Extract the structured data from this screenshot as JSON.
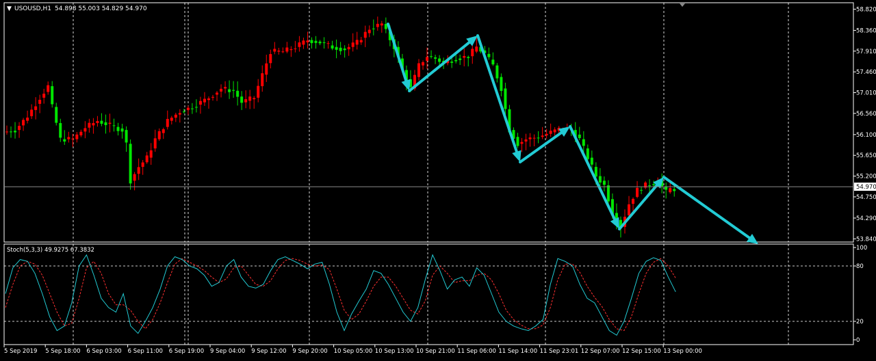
{
  "header": {
    "arrow_glyph": "▼",
    "symbol": "USOUSD,H1",
    "ohlc": "54.898 55.003 54.829 54.970"
  },
  "indicator": {
    "label": "Stoch(5,3,3) 49.9275 67.3832",
    "levels": [
      "100",
      "80",
      "20",
      "0"
    ]
  },
  "colors": {
    "background": "#000000",
    "bull": "#00e600",
    "bear": "#ff0000",
    "arrow": "#22cbd4",
    "grid": "#ffffff",
    "axis_text": "#ffffff",
    "bid_line": "#8c8c8c",
    "stoch_main": "#22cbd4",
    "stoch_signal": "#ff3030"
  },
  "chart_data": {
    "type": "candlestick",
    "price_axis": {
      "ticks": [
        "58.820",
        "58.360",
        "57.910",
        "57.460",
        "57.010",
        "56.560",
        "56.100",
        "55.650",
        "55.200",
        "54.750",
        "54.290",
        "53.840"
      ],
      "range": [
        53.8,
        58.9
      ],
      "current_price": "54.970",
      "current_value": 54.97
    },
    "time_labels": [
      "5 Sep 2019",
      "5 Sep 18:00",
      "6 Sep 03:00",
      "6 Sep 11:00",
      "6 Sep 19:00",
      "9 Sep 04:00",
      "9 Sep 12:00",
      "9 Sep 20:00",
      "10 Sep 05:00",
      "10 Sep 13:00",
      "10 Sep 21:00",
      "11 Sep 06:00",
      "11 Sep 14:00",
      "11 Sep 23:01",
      "12 Sep 07:00",
      "12 Sep 15:00",
      "13 Sep 00:00"
    ],
    "price_path": [
      [
        0,
        56.15
      ],
      [
        3,
        56.2
      ],
      [
        6,
        56.5
      ],
      [
        9,
        56.9
      ],
      [
        11,
        57.15
      ],
      [
        12,
        56.7
      ],
      [
        14,
        56.0
      ],
      [
        17,
        56.0
      ],
      [
        20,
        56.25
      ],
      [
        23,
        56.4
      ],
      [
        26,
        56.3
      ],
      [
        29,
        56.2
      ],
      [
        30,
        55.9
      ],
      [
        31,
        55.1
      ],
      [
        33,
        55.4
      ],
      [
        35,
        55.6
      ],
      [
        37,
        56.0
      ],
      [
        40,
        56.4
      ],
      [
        43,
        56.6
      ],
      [
        46,
        56.7
      ],
      [
        50,
        56.9
      ],
      [
        53,
        57.1
      ],
      [
        56,
        57.05
      ],
      [
        58,
        56.8
      ],
      [
        61,
        56.9
      ],
      [
        63,
        57.4
      ],
      [
        65,
        57.9
      ],
      [
        68,
        57.9
      ],
      [
        71,
        58.0
      ],
      [
        74,
        58.15
      ],
      [
        77,
        58.1
      ],
      [
        80,
        58.0
      ],
      [
        83,
        57.95
      ],
      [
        86,
        58.1
      ],
      [
        89,
        58.4
      ],
      [
        92,
        58.5
      ],
      [
        95,
        58.0
      ],
      [
        97,
        57.5
      ],
      [
        99,
        57.1
      ],
      [
        101,
        57.6
      ],
      [
        103,
        57.8
      ],
      [
        105,
        57.75
      ],
      [
        107,
        57.65
      ],
      [
        110,
        57.75
      ],
      [
        113,
        57.8
      ],
      [
        115,
        58.0
      ],
      [
        117,
        57.85
      ],
      [
        119,
        57.6
      ],
      [
        121,
        57.1
      ],
      [
        123,
        56.2
      ],
      [
        125,
        55.9
      ],
      [
        127,
        56.0
      ],
      [
        130,
        56.05
      ],
      [
        133,
        56.15
      ],
      [
        136,
        56.25
      ],
      [
        138,
        56.2
      ],
      [
        140,
        56.0
      ],
      [
        142,
        55.6
      ],
      [
        144,
        55.2
      ],
      [
        146,
        55.0
      ],
      [
        148,
        54.4
      ],
      [
        150,
        54.1
      ],
      [
        152,
        54.6
      ],
      [
        154,
        54.9
      ],
      [
        156,
        55.0
      ],
      [
        158,
        55.05
      ],
      [
        159,
        55.1
      ],
      [
        161,
        54.85
      ],
      [
        162,
        54.92
      ]
    ],
    "stochastic": {
      "main": [
        [
          0,
          50
        ],
        [
          1,
          78
        ],
        [
          2,
          87
        ],
        [
          3,
          85
        ],
        [
          4,
          72
        ],
        [
          5,
          50
        ],
        [
          6,
          25
        ],
        [
          7,
          10
        ],
        [
          8,
          15
        ],
        [
          9,
          40
        ],
        [
          10,
          80
        ],
        [
          11,
          92
        ],
        [
          12,
          70
        ],
        [
          13,
          45
        ],
        [
          14,
          35
        ],
        [
          15,
          30
        ],
        [
          16,
          50
        ],
        [
          17,
          15
        ],
        [
          18,
          7
        ],
        [
          19,
          20
        ],
        [
          20,
          35
        ],
        [
          21,
          55
        ],
        [
          22,
          80
        ],
        [
          23,
          90
        ],
        [
          24,
          87
        ],
        [
          25,
          80
        ],
        [
          26,
          77
        ],
        [
          27,
          70
        ],
        [
          28,
          58
        ],
        [
          29,
          62
        ],
        [
          30,
          80
        ],
        [
          31,
          87
        ],
        [
          32,
          68
        ],
        [
          33,
          58
        ],
        [
          34,
          56
        ],
        [
          35,
          60
        ],
        [
          36,
          75
        ],
        [
          37,
          87
        ],
        [
          38,
          90
        ],
        [
          39,
          86
        ],
        [
          40,
          82
        ],
        [
          41,
          77
        ],
        [
          42,
          82
        ],
        [
          43,
          84
        ],
        [
          44,
          60
        ],
        [
          45,
          30
        ],
        [
          46,
          10
        ],
        [
          47,
          28
        ],
        [
          48,
          42
        ],
        [
          49,
          55
        ],
        [
          50,
          75
        ],
        [
          51,
          72
        ],
        [
          52,
          60
        ],
        [
          53,
          45
        ],
        [
          54,
          30
        ],
        [
          55,
          20
        ],
        [
          56,
          35
        ],
        [
          57,
          65
        ],
        [
          58,
          92
        ],
        [
          59,
          75
        ],
        [
          60,
          55
        ],
        [
          61,
          65
        ],
        [
          62,
          68
        ],
        [
          63,
          58
        ],
        [
          64,
          78
        ],
        [
          65,
          70
        ],
        [
          66,
          50
        ],
        [
          67,
          30
        ],
        [
          68,
          20
        ],
        [
          69,
          15
        ],
        [
          70,
          12
        ],
        [
          71,
          10
        ],
        [
          72,
          15
        ],
        [
          73,
          22
        ],
        [
          74,
          60
        ],
        [
          75,
          88
        ],
        [
          76,
          85
        ],
        [
          77,
          80
        ],
        [
          78,
          60
        ],
        [
          79,
          45
        ],
        [
          80,
          40
        ],
        [
          81,
          25
        ],
        [
          82,
          10
        ],
        [
          83,
          5
        ],
        [
          84,
          20
        ],
        [
          85,
          45
        ],
        [
          86,
          72
        ],
        [
          87,
          85
        ],
        [
          88,
          89
        ],
        [
          89,
          86
        ],
        [
          90,
          68
        ],
        [
          91,
          52
        ]
      ],
      "signal": [
        [
          0,
          35
        ],
        [
          1,
          60
        ],
        [
          2,
          80
        ],
        [
          3,
          85
        ],
        [
          4,
          82
        ],
        [
          5,
          70
        ],
        [
          6,
          50
        ],
        [
          7,
          30
        ],
        [
          8,
          15
        ],
        [
          9,
          18
        ],
        [
          10,
          45
        ],
        [
          11,
          78
        ],
        [
          12,
          85
        ],
        [
          13,
          72
        ],
        [
          14,
          50
        ],
        [
          15,
          38
        ],
        [
          16,
          38
        ],
        [
          17,
          32
        ],
        [
          18,
          20
        ],
        [
          19,
          12
        ],
        [
          20,
          22
        ],
        [
          21,
          40
        ],
        [
          22,
          62
        ],
        [
          23,
          82
        ],
        [
          24,
          88
        ],
        [
          25,
          84
        ],
        [
          26,
          80
        ],
        [
          27,
          75
        ],
        [
          28,
          68
        ],
        [
          29,
          62
        ],
        [
          30,
          66
        ],
        [
          31,
          78
        ],
        [
          32,
          80
        ],
        [
          33,
          70
        ],
        [
          34,
          60
        ],
        [
          35,
          58
        ],
        [
          36,
          64
        ],
        [
          37,
          77
        ],
        [
          38,
          86
        ],
        [
          39,
          88
        ],
        [
          40,
          86
        ],
        [
          41,
          82
        ],
        [
          42,
          80
        ],
        [
          43,
          81
        ],
        [
          44,
          76
        ],
        [
          45,
          55
        ],
        [
          46,
          32
        ],
        [
          47,
          22
        ],
        [
          48,
          28
        ],
        [
          49,
          42
        ],
        [
          50,
          58
        ],
        [
          51,
          68
        ],
        [
          52,
          68
        ],
        [
          53,
          58
        ],
        [
          54,
          45
        ],
        [
          55,
          32
        ],
        [
          56,
          28
        ],
        [
          57,
          42
        ],
        [
          58,
          70
        ],
        [
          59,
          80
        ],
        [
          60,
          72
        ],
        [
          61,
          62
        ],
        [
          62,
          64
        ],
        [
          63,
          64
        ],
        [
          64,
          70
        ],
        [
          65,
          72
        ],
        [
          66,
          65
        ],
        [
          67,
          50
        ],
        [
          68,
          32
        ],
        [
          69,
          22
        ],
        [
          70,
          16
        ],
        [
          71,
          12
        ],
        [
          72,
          12
        ],
        [
          73,
          16
        ],
        [
          74,
          35
        ],
        [
          75,
          65
        ],
        [
          76,
          82
        ],
        [
          77,
          82
        ],
        [
          78,
          73
        ],
        [
          79,
          58
        ],
        [
          80,
          46
        ],
        [
          81,
          36
        ],
        [
          82,
          22
        ],
        [
          83,
          12
        ],
        [
          84,
          10
        ],
        [
          85,
          25
        ],
        [
          86,
          50
        ],
        [
          87,
          72
        ],
        [
          88,
          84
        ],
        [
          89,
          88
        ],
        [
          90,
          80
        ],
        [
          91,
          67
        ]
      ]
    }
  }
}
